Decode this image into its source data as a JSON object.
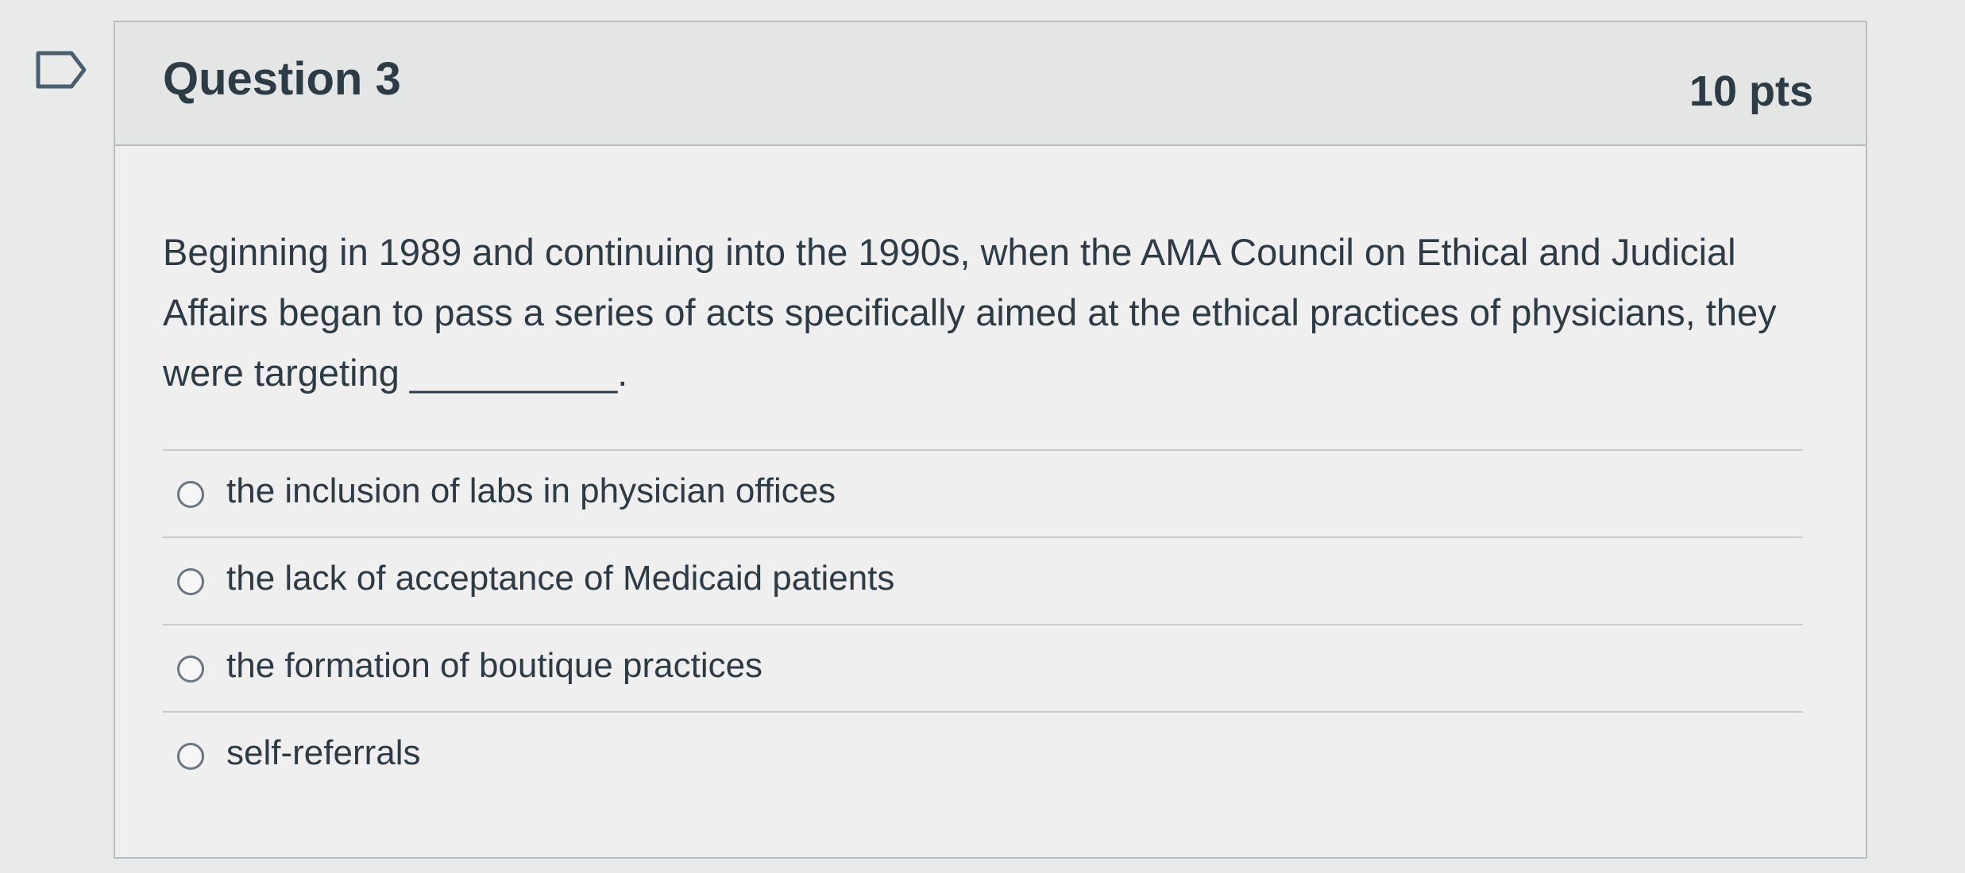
{
  "question": {
    "title": "Question 3",
    "points": "10 pts",
    "text": "Beginning in 1989 and continuing into the 1990s, when the AMA Council on Ethical and Judicial Affairs began to pass a series of acts specifically aimed at the ethical practices of physicians, they were targeting __________."
  },
  "answers": [
    {
      "label": "the inclusion of labs in physician offices"
    },
    {
      "label": "the lack of acceptance of Medicaid patients"
    },
    {
      "label": "the formation of boutique practices"
    },
    {
      "label": "self-referrals"
    }
  ],
  "icons": {
    "flag": "flag-icon",
    "radio": "radio-icon"
  },
  "colors": {
    "text": "#2d3b45",
    "header_bg": "#e4e6e6",
    "border": "#b9bcbe",
    "flag": "#4b5e6d"
  }
}
